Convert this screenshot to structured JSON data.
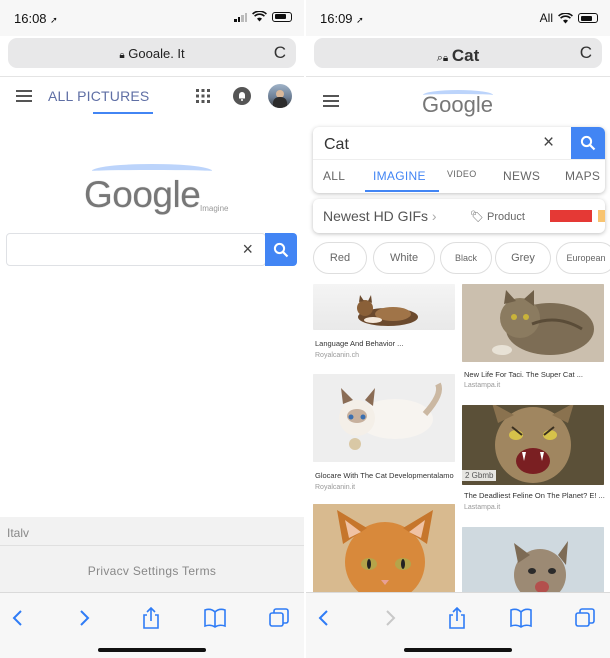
{
  "left": {
    "status": {
      "time": "16:08"
    },
    "url": "Gooale. It",
    "reload": "C",
    "nav": {
      "all_pictures": "ALL PICTURES"
    },
    "logo": {
      "word": "Google",
      "sub": "Imagine"
    },
    "search": {
      "value": "",
      "clear": "×"
    },
    "footer": {
      "country": "Italv",
      "links": "Privacv Settings Terms"
    }
  },
  "right": {
    "status": {
      "time": "16:09",
      "carrier": "All"
    },
    "url": "Cat",
    "reload": "C",
    "logo": {
      "word": "Google"
    },
    "search": {
      "value": "Cat",
      "clear": "×"
    },
    "tabs": [
      "ALL",
      "IMAGINE",
      "VIDEO",
      "NEWS",
      "MAPS"
    ],
    "active_tab": "IMAGINE",
    "suggest": {
      "text": "Newest HD GIFs",
      "product": "Product",
      "swatches": [
        "#e53935",
        "#f8c471"
      ]
    },
    "chips": [
      "Red",
      "White",
      "Black",
      "Grey",
      "European"
    ],
    "results": [
      {
        "caption": "Language And Behavior ...",
        "source": "Royalcanin.ch"
      },
      {
        "caption": "New Life For Taci. The Super Cat ...",
        "source": "Lastampa.it"
      },
      {
        "caption": "Glocare With The Cat Developmentalamo",
        "source": "Royalcanin.it"
      },
      {
        "badge": "2 Gbmb",
        "caption": "The Deadliest Feline On The Planet? E! ...",
        "source": "Lastampa.it"
      }
    ]
  },
  "colors": {
    "accent": "#4285f4",
    "tab_active": "#4285f4",
    "footer_bg": "#f2f2f2"
  }
}
